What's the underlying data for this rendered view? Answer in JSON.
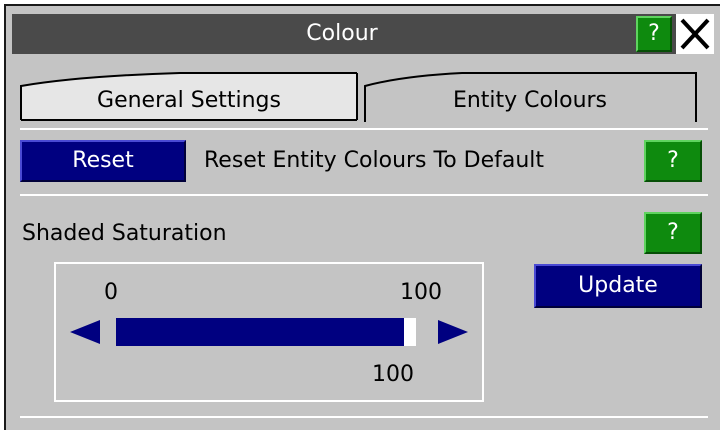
{
  "window": {
    "title": "Colour",
    "help_label": "?",
    "close_icon": "close-icon"
  },
  "tabs": [
    {
      "label": "General Settings",
      "active": false
    },
    {
      "label": "Entity Colours",
      "active": true
    }
  ],
  "reset_row": {
    "button_label": "Reset",
    "description": "Reset Entity Colours To Default",
    "help_label": "?"
  },
  "saturation": {
    "label": "Shaded Saturation",
    "help_label": "?",
    "min_label": "0",
    "max_label": "100",
    "min": 0,
    "max": 100,
    "value": 100,
    "value_label": "100",
    "update_label": "Update",
    "left_icon": "arrow-left-icon",
    "right_icon": "arrow-right-icon"
  },
  "colors": {
    "panel": "#c4c4c4",
    "titlebar": "#4a4a4a",
    "help_green": "#0e8a0e",
    "button_navy": "#000080"
  }
}
